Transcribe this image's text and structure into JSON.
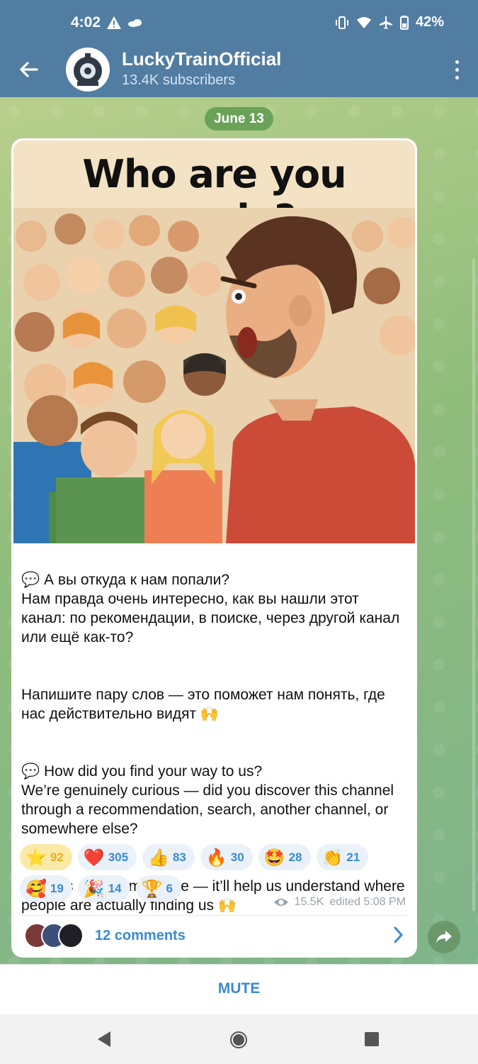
{
  "status_bar": {
    "time": "4:02",
    "battery": "42%"
  },
  "header": {
    "channel_name": "LuckyTrainOfficial",
    "subscribers": "13.4K subscribers"
  },
  "date_label": "June 13",
  "post": {
    "image_heading": "Who are you people?",
    "paragraphs": [
      "💬 А вы откуда к нам попали?\nНам правда очень интересно, как вы нашли этот канал: по рекомендации, в поиске, через другой канал или ещё как-то?",
      "Напишите пару слов — это поможет нам понять, где нас действительно видят 🙌",
      "💬 How did you find your way to us?\nWe’re genuinely curious — did you discover this channel through a recommendation, search, another channel, or somewhere else?",
      "Drop us a quick message — it’ll help us understand where people are actually finding us 🙌"
    ],
    "reactions": [
      {
        "emoji": "⭐",
        "count": "92",
        "active": true
      },
      {
        "emoji": "❤️",
        "count": "305"
      },
      {
        "emoji": "👍",
        "count": "83"
      },
      {
        "emoji": "🔥",
        "count": "30"
      },
      {
        "emoji": "🤩",
        "count": "28"
      },
      {
        "emoji": "👏",
        "count": "21"
      },
      {
        "emoji": "🥰",
        "count": "19"
      },
      {
        "emoji": "🎉",
        "count": "14"
      },
      {
        "emoji": "🏆",
        "count": "6"
      }
    ],
    "views": "15.5K",
    "edited": "edited 5:08 PM",
    "comments": "12 comments"
  },
  "bottom": {
    "mute_label": "MUTE"
  },
  "colors": {
    "header_bg": "#527da3",
    "accent": "#3a8ad1",
    "date_pill": "#6aa258"
  }
}
